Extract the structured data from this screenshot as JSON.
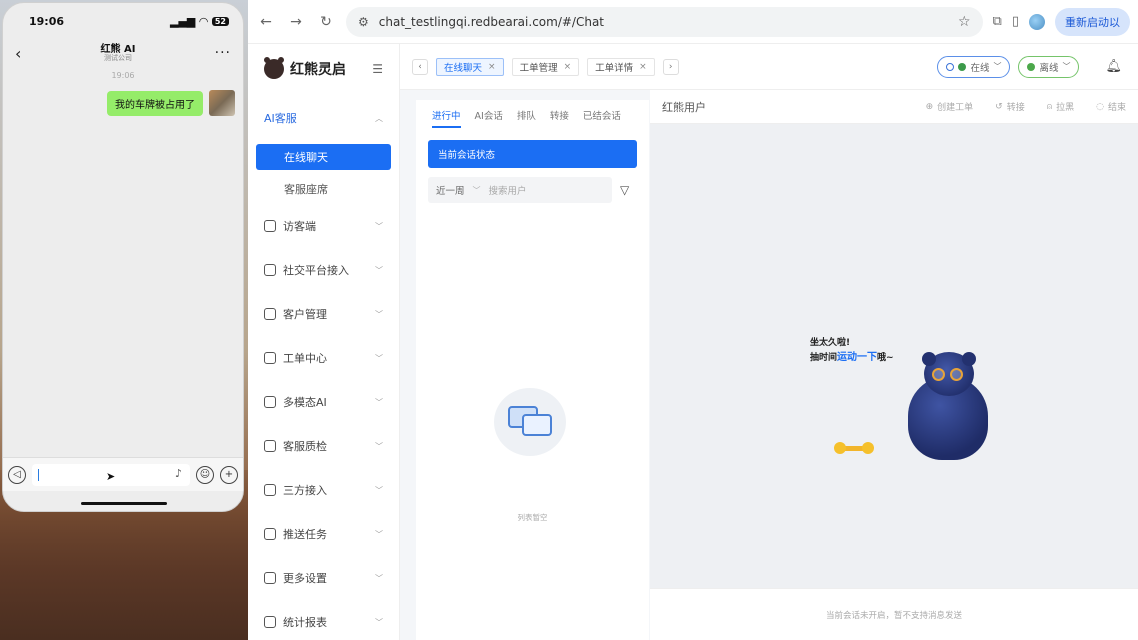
{
  "phone": {
    "time": "19:06",
    "battery": "52",
    "contact_name": "红熊 AI",
    "contact_sub": "测试公司",
    "message_time": "19:06",
    "message_text": "我的车牌被占用了"
  },
  "browser": {
    "url": "chat_testlingqi.redbearai.com/#/Chat",
    "relaunch_label": "重新启动以"
  },
  "app": {
    "logo_text": "红熊灵启",
    "menu": {
      "ai_service": "AI客服",
      "online_chat": "在线聊天",
      "agent_seat": "客服座席",
      "visitor": "访客端",
      "social": "社交平台接入",
      "customer": "客户管理",
      "ticket": "工单中心",
      "multimodal": "多模态AI",
      "quality": "客服质检",
      "third_party": "三方接入",
      "push": "推送任务",
      "settings": "更多设置",
      "report": "统计报表"
    },
    "tabs": [
      "在线聊天",
      "工单管理",
      "工单详情"
    ],
    "status_online": "在线",
    "status_offline": "离线",
    "conv_tabs": [
      "进行中",
      "AI会话",
      "排队",
      "转接",
      "已结会话"
    ],
    "conv_status_btn": "当前会话状态",
    "range_value": "近一周",
    "search_placeholder": "搜索用户",
    "empty_list": "列表暂空",
    "chat_user": "红熊用户",
    "actions": [
      "创建工单",
      "转接",
      "拉黑",
      "结束"
    ],
    "idle_line1": "坐太久啦!",
    "idle_line2_pre": "抽时间",
    "idle_line2_hl": "运动一下",
    "idle_line2_post": "哦~",
    "chat_footer": "当前会话未开启，暂不支持消息发送"
  }
}
